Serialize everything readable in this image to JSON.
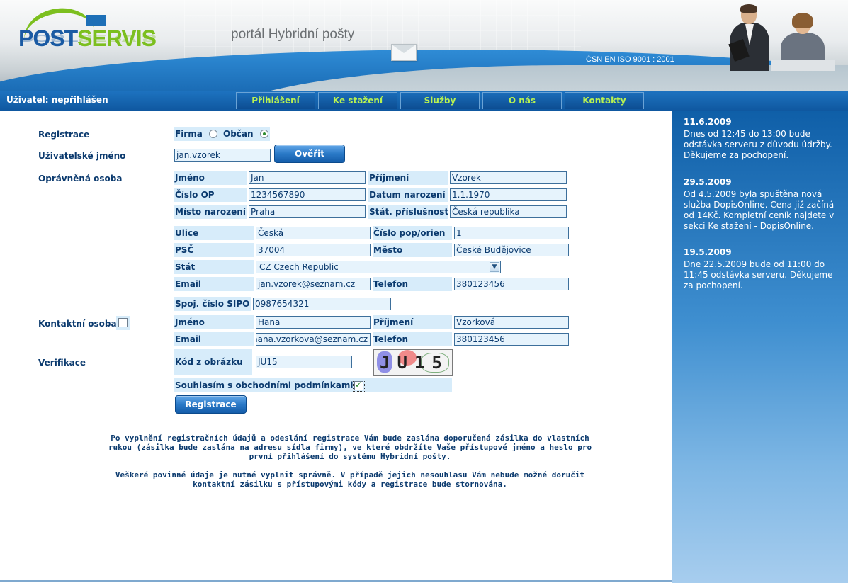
{
  "header": {
    "logo_part1": "POST",
    "logo_part2": "SERVIS",
    "portal_title": "portál  Hybridní pošty",
    "iso": "ČSN EN ISO 9001 : 2001"
  },
  "nav": {
    "user_status": "Uživatel: nepřihlášen",
    "items": [
      "Přihlášení",
      "Ke stažení",
      "Služby",
      "O nás",
      "Kontakty"
    ]
  },
  "form": {
    "registrace_label": "Registrace",
    "firma_label": "Firma",
    "obcan_label": "Občan",
    "selected_type": "Občan",
    "username_label": "Uživatelské jméno",
    "username_value": "jan.vzorek",
    "verify_button": "Ověřit",
    "opravnena_osoba_label": "Oprávněná osoba",
    "jmeno_label": "Jméno",
    "jmeno_value": "Jan",
    "prijmeni_label": "Příjmení",
    "prijmeni_value": "Vzorek",
    "cislo_op_label": "Číslo OP",
    "cislo_op_value": "1234567890",
    "datum_narozeni_label": "Datum narození",
    "datum_narozeni_value": "1.1.1970",
    "misto_narozeni_label": "Místo narození",
    "misto_narozeni_value": "Praha",
    "stat_prislusnost_label": "Stát. příslušnost",
    "stat_prislusnost_value": "Česká republika",
    "ulice_label": "Ulice",
    "ulice_value": "Česká",
    "cislo_pop_label": "Číslo pop/orien",
    "cislo_pop_value": "1",
    "psc_label": "PSČ",
    "psc_value": "37004",
    "mesto_label": "Město",
    "mesto_value": "České Budějovice",
    "stat_label": "Stát",
    "stat_value": "CZ Czech Republic",
    "email_label": "Email",
    "email_value": "jan.vzorek@seznam.cz",
    "telefon_label": "Telefon",
    "telefon_value": "380123456",
    "sipo_label": "Spoj. číslo SIPO",
    "sipo_value": "0987654321",
    "kontaktni_osoba_label": "Kontaktní osoba",
    "k_jmeno_label": "Jméno",
    "k_jmeno_value": "Hana",
    "k_prijmeni_label": "Příjmení",
    "k_prijmeni_value": "Vzorková",
    "k_email_label": "Email",
    "k_email_value": "hana.vzorkova@seznam.cz",
    "k_telefon_label": "Telefon",
    "k_telefon_value": "380123456",
    "verifikace_label": "Verifikace",
    "kod_label": "Kód z obrázku",
    "kod_value": "JU15",
    "captcha_text": "JU15",
    "souhlas_label": "Souhlasím s obchodními podmínkami",
    "submit_button": "Registrace"
  },
  "info": {
    "p1_line1": "Po vyplnění registračních údajů a odeslání registrace Vám bude zaslána doporučená zásilka do vlastních",
    "p1_line2": "rukou (zásilka bude zaslána na adresu sídla firmy), ve které obdržíte Vaše přístupové jméno a heslo pro",
    "p1_line3": "první přihlášení do systému Hybridní pošty.",
    "p2_line1": "Veškeré povinné údaje je nutné vyplnit správně. V případě jejich nesouhlasu Vám nebude možné doručit",
    "p2_line2": "kontaktní zásilku s přístupovými kódy a registrace bude stornována."
  },
  "news": [
    {
      "date": "11.6.2009",
      "text": "Dnes od 12:45 do 13:00 bude odstávka serveru z důvodu údržby. Děkujeme za pochopení."
    },
    {
      "date": "29.5.2009",
      "text": "Od 4.5.2009 byla spuštěna nová služba DopisOnline. Cena již začíná od 14Kč. Kompletní ceník najdete v sekci Ke stažení - DopisOnline."
    },
    {
      "date": "19.5.2009",
      "text": "Dne 22.5.2009 bude od 11:00 do 11:45 odstávka serveru. Děkujeme za pochopení."
    }
  ],
  "colors": {
    "brand_blue": "#1a5aa3",
    "brand_green": "#7cbf1f",
    "nav_text": "#b9f251",
    "label_text": "#0b3a6e",
    "field_bg": "#d7ecfa"
  }
}
